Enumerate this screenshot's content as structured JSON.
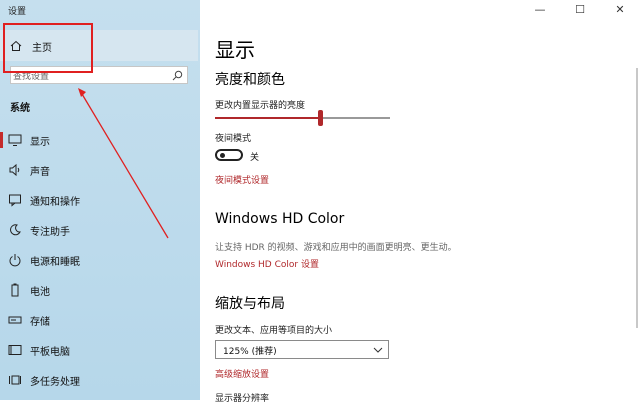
{
  "window": {
    "title": "设置",
    "controls": {
      "minimize": "—",
      "maximize": "☐",
      "close": "✕"
    }
  },
  "sidebar": {
    "home_label": "主页",
    "search_placeholder": "查找设置",
    "section": "系统",
    "items": [
      {
        "label": "显示",
        "icon": "monitor-icon",
        "active": true
      },
      {
        "label": "声音",
        "icon": "speaker-icon",
        "active": false
      },
      {
        "label": "通知和操作",
        "icon": "notification-icon",
        "active": false
      },
      {
        "label": "专注助手",
        "icon": "moon-icon",
        "active": false
      },
      {
        "label": "电源和睡眠",
        "icon": "power-icon",
        "active": false
      },
      {
        "label": "电池",
        "icon": "battery-icon",
        "active": false
      },
      {
        "label": "存储",
        "icon": "storage-icon",
        "active": false
      },
      {
        "label": "平板电脑",
        "icon": "tablet-icon",
        "active": false
      },
      {
        "label": "多任务处理",
        "icon": "multitask-icon",
        "active": false
      }
    ]
  },
  "main": {
    "title": "显示",
    "brightness_section": "亮度和颜色",
    "brightness_label": "更改内置显示器的亮度",
    "brightness_level": 0.6,
    "night_light_label": "夜间模式",
    "night_light_state": "关",
    "night_light_settings_link": "夜间模式设置",
    "hdr_title": "Windows HD Color",
    "hdr_desc": "让支持 HDR 的视频、游戏和应用中的画面更明亮、更生动。",
    "hdr_link": "Windows HD Color 设置",
    "scale_title": "缩放与布局",
    "scale_label": "更改文本、应用等项目的大小",
    "scale_value": "125% (推荐)",
    "advanced_scaling_link": "高级缩放设置",
    "resolution_label": "显示器分辨率"
  },
  "colors": {
    "accent": "#b0282b",
    "sidebar_bg": "#c5dfee",
    "annotation": "#e02020"
  }
}
